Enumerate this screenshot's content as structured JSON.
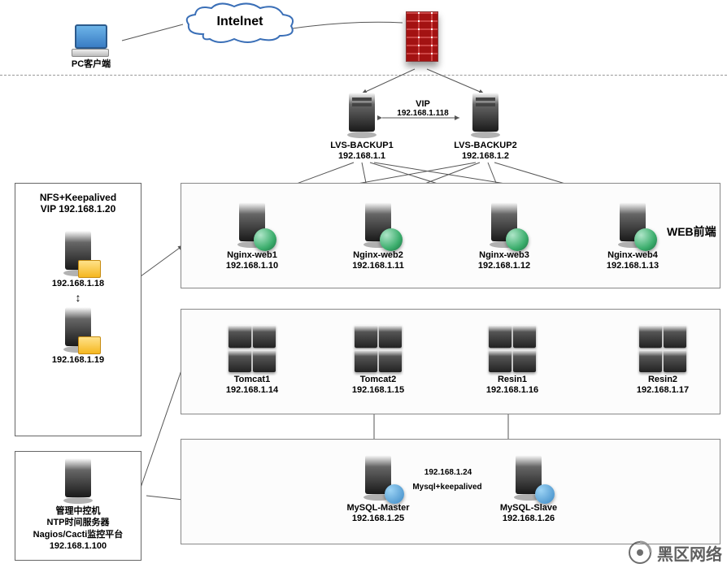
{
  "top": {
    "pc_label": "PC客户端",
    "cloud_label": "Intelnet"
  },
  "lvs": {
    "vip_label": "VIP",
    "vip_ip": "192.168.1.118",
    "b1_name": "LVS-BACKUP1",
    "b1_ip": "192.168.1.1",
    "b2_name": "LVS-BACKUP2",
    "b2_ip": "192.168.1.2"
  },
  "web": {
    "title": "WEB前端",
    "n": [
      {
        "name": "Nginx-web1",
        "ip": "192.168.1.10"
      },
      {
        "name": "Nginx-web2",
        "ip": "192.168.1.11"
      },
      {
        "name": "Nginx-web3",
        "ip": "192.168.1.12"
      },
      {
        "name": "Nginx-web4",
        "ip": "192.168.1.13"
      }
    ]
  },
  "app": [
    {
      "name": "Tomcat1",
      "ip": "192.168.1.14"
    },
    {
      "name": "Tomcat2",
      "ip": "192.168.1.15"
    },
    {
      "name": "Resin1",
      "ip": "192.168.1.16"
    },
    {
      "name": "Resin2",
      "ip": "192.168.1.17"
    }
  ],
  "db": {
    "vip": "192.168.1.24",
    "ha": "Mysql+keepalived",
    "master_name": "MySQL-Master",
    "master_ip": "192.168.1.25",
    "slave_name": "MySQL-Slave",
    "slave_ip": "192.168.1.26"
  },
  "nfs": {
    "title1": "NFS+Keepalived",
    "title2": "VIP 192.168.1.20",
    "ip1": "192.168.1.18",
    "ip2": "192.168.1.19"
  },
  "mgmt": {
    "l1": "管理中控机",
    "l2": "NTP时间服务器",
    "l3": "Nagios/Cacti监控平台",
    "ip": "192.168.1.100"
  },
  "watermark": "黑区网络"
}
